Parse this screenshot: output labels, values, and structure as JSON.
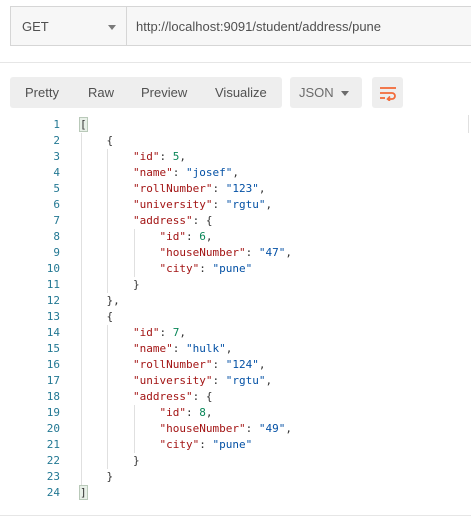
{
  "request": {
    "method": "GET",
    "url": "http://localhost:9091/student/address/pune"
  },
  "response_tabs": [
    "Pretty",
    "Raw",
    "Preview",
    "Visualize"
  ],
  "active_tab": "Pretty",
  "format": "JSON",
  "icons": {
    "wrap": "wrap-lines-icon",
    "method_dropdown": "chevron-down-icon",
    "format_dropdown": "chevron-down-icon"
  },
  "colors": {
    "accent": "#f26b3a",
    "key": "#a31515",
    "string": "#0451a5",
    "number": "#098658",
    "line_number": "#237893"
  },
  "lines": [
    {
      "n": "1",
      "text": "["
    },
    {
      "n": "2",
      "text": "    {"
    },
    {
      "n": "3",
      "text": "        \"id\": 5,"
    },
    {
      "n": "4",
      "text": "        \"name\": \"josef\","
    },
    {
      "n": "5",
      "text": "        \"rollNumber\": \"123\","
    },
    {
      "n": "6",
      "text": "        \"university\": \"rgtu\","
    },
    {
      "n": "7",
      "text": "        \"address\": {"
    },
    {
      "n": "8",
      "text": "            \"id\": 6,"
    },
    {
      "n": "9",
      "text": "            \"houseNumber\": \"47\","
    },
    {
      "n": "10",
      "text": "            \"city\": \"pune\""
    },
    {
      "n": "11",
      "text": "        }"
    },
    {
      "n": "12",
      "text": "    },"
    },
    {
      "n": "13",
      "text": "    {"
    },
    {
      "n": "14",
      "text": "        \"id\": 7,"
    },
    {
      "n": "15",
      "text": "        \"name\": \"hulk\","
    },
    {
      "n": "16",
      "text": "        \"rollNumber\": \"124\","
    },
    {
      "n": "17",
      "text": "        \"university\": \"rgtu\","
    },
    {
      "n": "18",
      "text": "        \"address\": {"
    },
    {
      "n": "19",
      "text": "            \"id\": 8,"
    },
    {
      "n": "20",
      "text": "            \"houseNumber\": \"49\","
    },
    {
      "n": "21",
      "text": "            \"city\": \"pune\""
    },
    {
      "n": "22",
      "text": "        }"
    },
    {
      "n": "23",
      "text": "    }"
    },
    {
      "n": "24",
      "text": "]"
    }
  ]
}
